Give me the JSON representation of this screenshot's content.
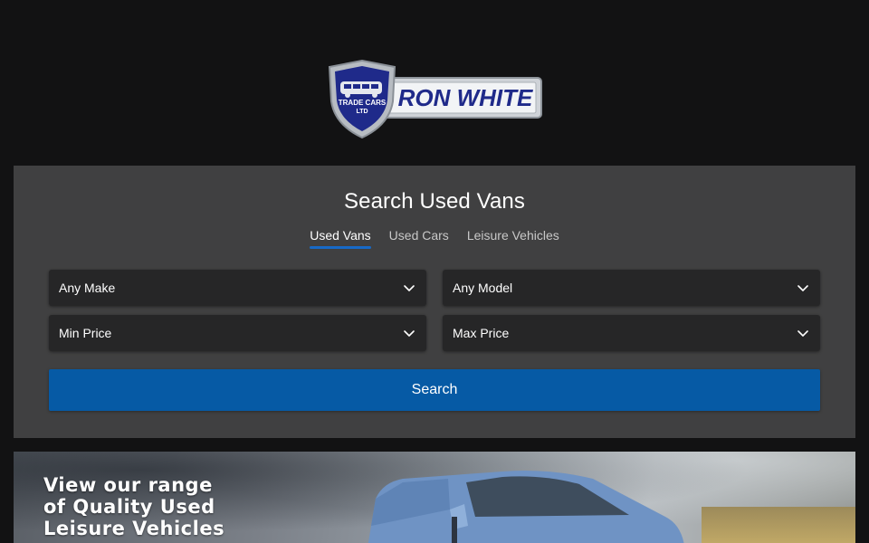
{
  "logo": {
    "badge_line1": "TRADE CARS",
    "badge_line2": "LTD",
    "brand": "RON WHITE"
  },
  "search": {
    "title": "Search Used Vans",
    "tabs": [
      {
        "label": "Used Vans",
        "active": true
      },
      {
        "label": "Used Cars",
        "active": false
      },
      {
        "label": "Leisure Vehicles",
        "active": false
      }
    ],
    "make": "Any Make",
    "model": "Any Model",
    "min_price": "Min Price",
    "max_price": "Max Price",
    "button_label": "Search"
  },
  "banner": {
    "line1": "View our range",
    "line2": "of Quality Used",
    "line3": "Leisure Vehicles"
  },
  "colors": {
    "page_bg": "#121213",
    "panel_bg": "#404041",
    "select_bg": "#262627",
    "accent": "#065aa5",
    "tab_underline": "#1769c7"
  },
  "icons": {
    "select_arrow": "chevron-down-icon",
    "logo": "shield-van-icon"
  }
}
